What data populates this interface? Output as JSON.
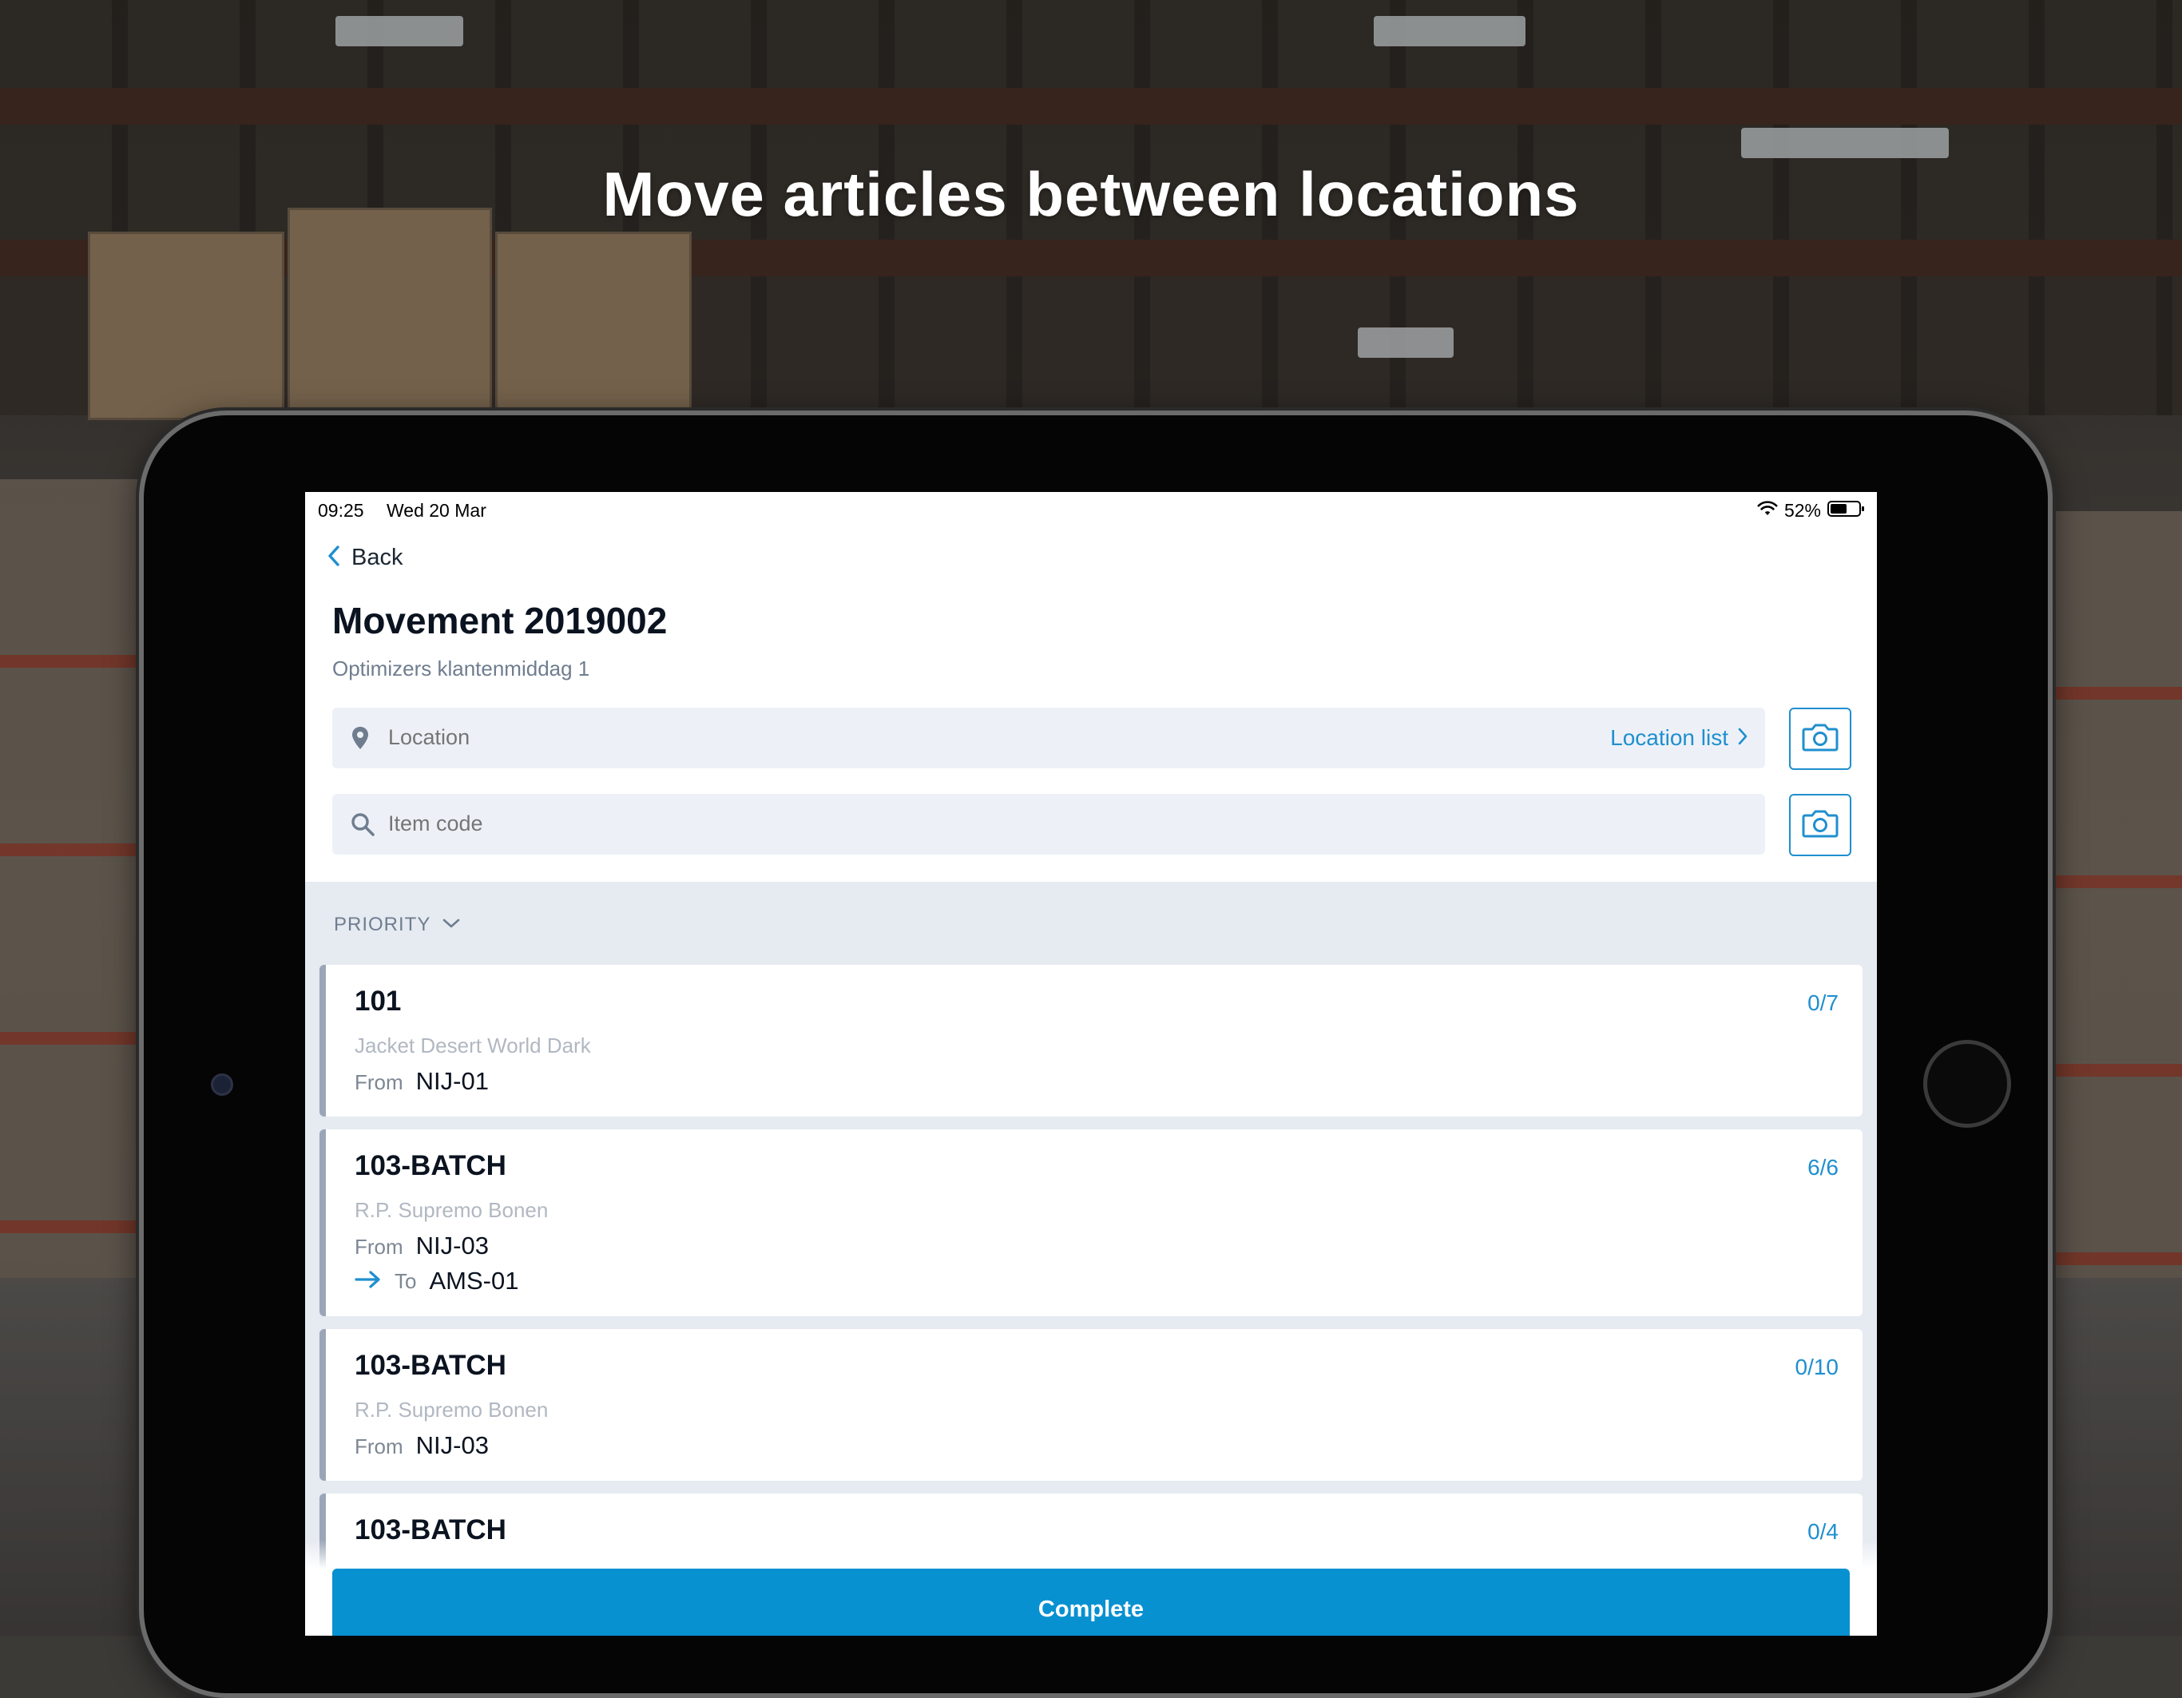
{
  "headline": "Move articles between locations",
  "status_bar": {
    "time": "09:25",
    "date": "Wed 20 Mar",
    "battery": "52%"
  },
  "nav": {
    "back_label": "Back"
  },
  "header": {
    "title": "Movement 2019002",
    "subtitle": "Optimizers klantenmiddag 1"
  },
  "location": {
    "placeholder": "Location",
    "link_label": "Location list"
  },
  "item": {
    "placeholder": "Item code"
  },
  "sort": {
    "label": "PRIORITY"
  },
  "items": [
    {
      "code": "101",
      "description": "Jacket Desert World Dark",
      "qty": "0/7",
      "from_label": "From",
      "from": "NIJ-01"
    },
    {
      "code": "103-BATCH",
      "description": "R.P. Supremo Bonen",
      "qty": "6/6",
      "from_label": "From",
      "from": "NIJ-03",
      "to_label": "To",
      "to": "AMS-01"
    },
    {
      "code": "103-BATCH",
      "description": "R.P. Supremo Bonen",
      "qty": "0/10",
      "from_label": "From",
      "from": "NIJ-03"
    },
    {
      "code": "103-BATCH",
      "qty": "0/4"
    }
  ],
  "actions": {
    "complete_label": "Complete"
  },
  "colors": {
    "accent": "#1f8fcf",
    "primary_button": "#0891d1",
    "field_bg": "#edf1f7",
    "list_bg": "#e6eaf1"
  },
  "icons": [
    "chevron-left-icon",
    "location-pin-icon",
    "chevron-right-icon",
    "camera-icon",
    "search-icon",
    "chevron-down-icon",
    "arrow-right-icon",
    "wifi-icon",
    "battery-icon"
  ]
}
